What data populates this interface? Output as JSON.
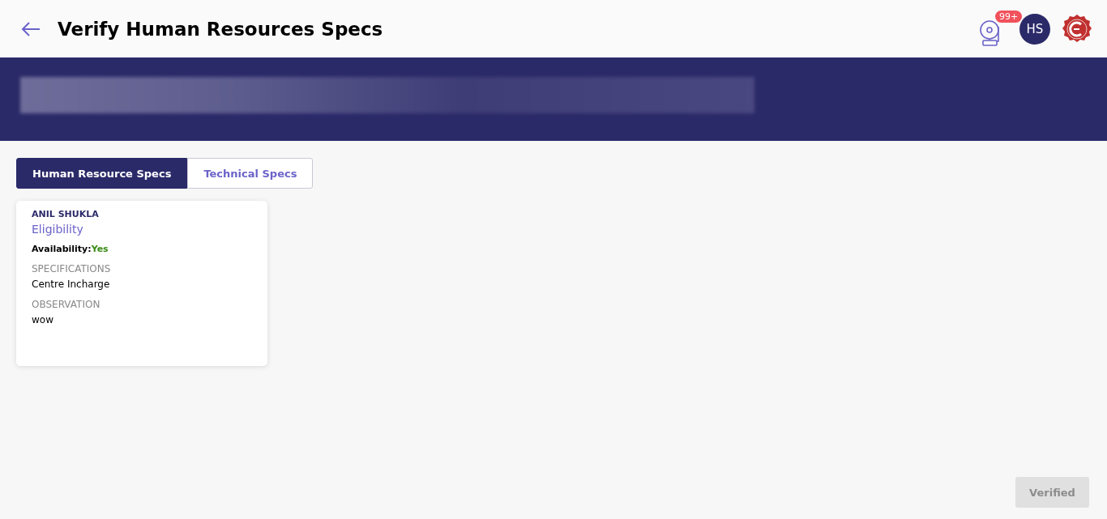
{
  "header": {
    "title": "Verify Human Resources Specs",
    "notification_count": "99+",
    "avatar_initials": "HS"
  },
  "tabs": [
    {
      "label": "Human Resource Specs",
      "selected": true
    },
    {
      "label": "Technical Specs",
      "selected": false
    }
  ],
  "cards": [
    {
      "name": "ANIL SHUKLA",
      "category": "Eligibility",
      "availability_label": "Availability:",
      "availability_value": "Yes",
      "available": true,
      "fields": [
        {
          "label": "SPECIFICATIONS",
          "value": "Centre Incharge"
        },
        {
          "label": "OBSERVATION",
          "value": "wow"
        }
      ]
    }
  ],
  "verify_button": {
    "label": "Verified",
    "disabled": true
  }
}
